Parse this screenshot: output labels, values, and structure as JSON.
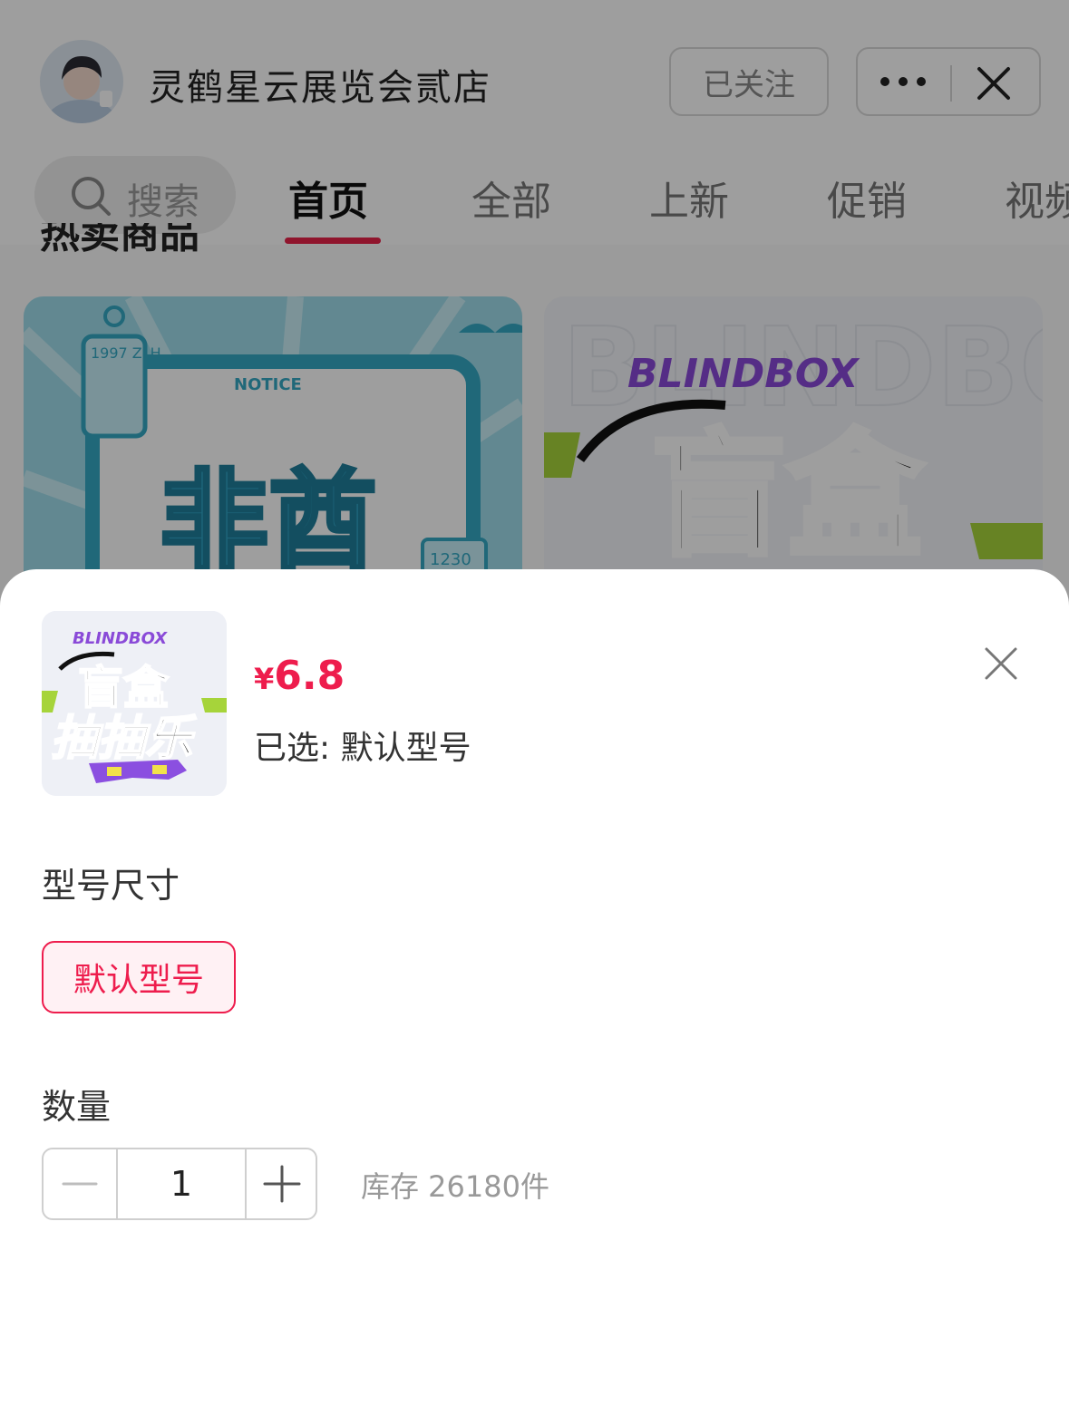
{
  "store": {
    "name": "灵鹤星云展览会贰店",
    "follow_label": "已关注"
  },
  "search": {
    "label": "搜索"
  },
  "tabs": [
    {
      "label": "首页",
      "active": true
    },
    {
      "label": "全部",
      "active": false
    },
    {
      "label": "上新",
      "active": false
    },
    {
      "label": "促销",
      "active": false
    },
    {
      "label": "视频",
      "active": false
    }
  ],
  "section": {
    "title": "热卖商品"
  },
  "products": [
    {
      "notice_tag": "NOTICE",
      "title_text": "非酋",
      "tag_top": "1997 ZLH",
      "tag_bottom": "1230"
    },
    {
      "brand": "BLINDBOX",
      "title_text": "盲盒"
    }
  ],
  "sheet": {
    "thumb": {
      "brand": "BLINDBOX",
      "line1": "盲盒",
      "line2": "抽抽乐"
    },
    "price_currency": "¥",
    "price_value": "6.8",
    "selected_text": "已选: 默认型号",
    "spec_label": "型号尺寸",
    "spec_option": "默认型号",
    "quantity_label": "数量",
    "quantity_value": "1",
    "stock_text": "库存 26180件"
  },
  "colors": {
    "accent": "#ee1d4d",
    "overlay": "rgba(0,0,0,0.38)"
  }
}
